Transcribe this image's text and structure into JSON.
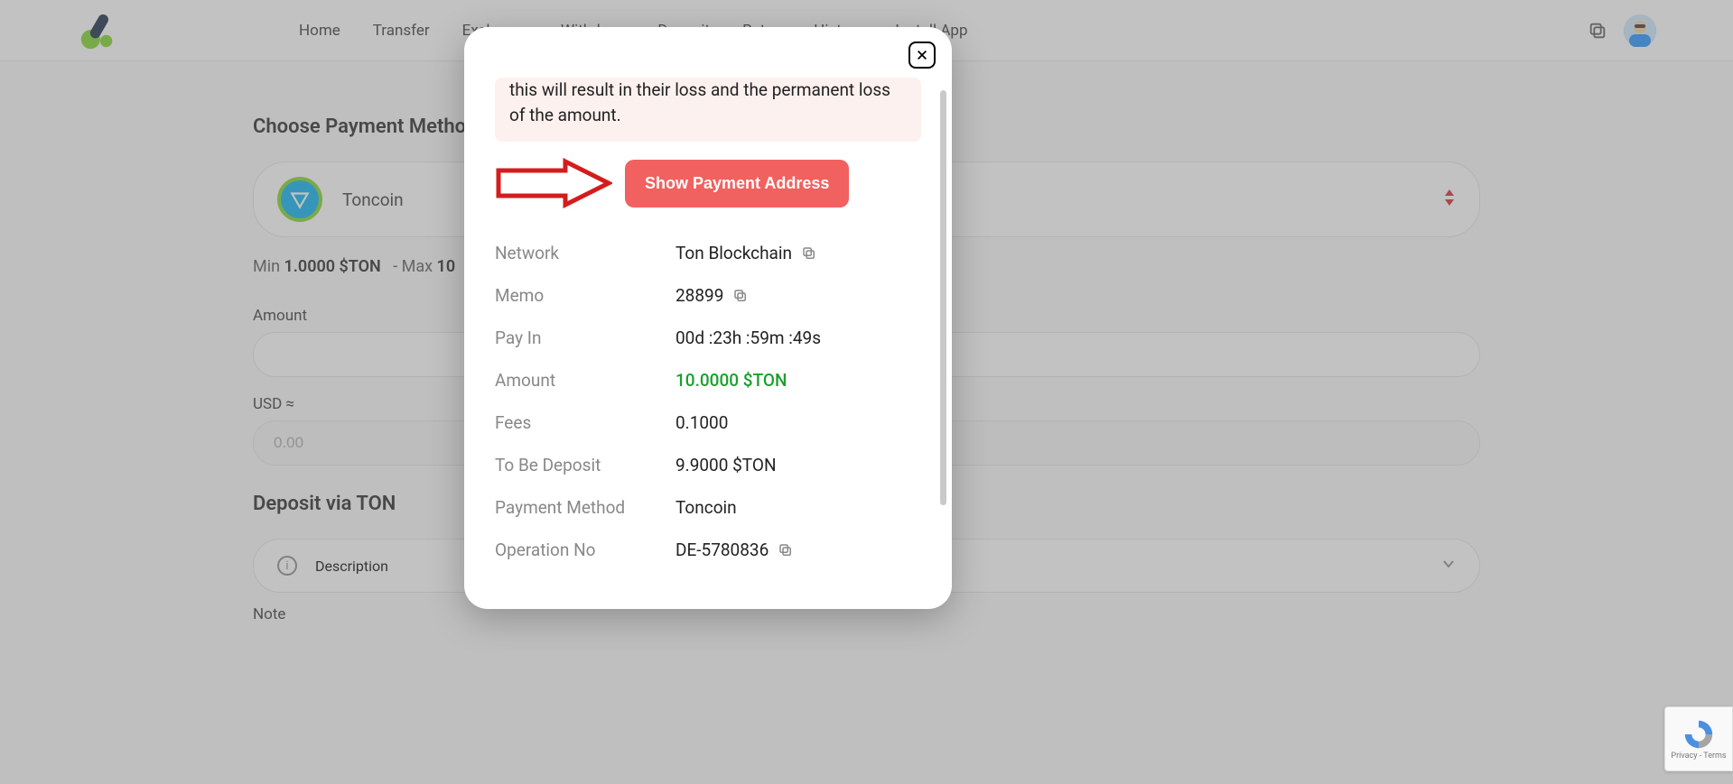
{
  "nav": {
    "home": "Home",
    "transfer": "Transfer",
    "exchange": "Exchange",
    "withdraw": "Withdraw",
    "deposit": "Deposit",
    "rates": "Rates",
    "history": "History",
    "install": "Install App"
  },
  "page": {
    "choose_method_label": "Choose Payment Method",
    "payment_method_selected": "Toncoin",
    "min_label": "Min",
    "min_value": "1.0000 $TON",
    "max_label": "-  Max",
    "max_value": "10",
    "amount_label": "Amount",
    "usd_label": "USD ≈",
    "usd_placeholder": "0.00",
    "deposit_via_label": "Deposit via TON",
    "description_label": "Description",
    "note_label": "Note"
  },
  "modal": {
    "warning_text": "this will result in their loss and the permanent loss of the amount.",
    "show_address_btn": "Show Payment Address",
    "network_k": "Network",
    "network_v": "Ton Blockchain",
    "memo_k": "Memo",
    "memo_v": "28899",
    "payin_k": "Pay In",
    "payin_v": "00d :23h :59m :49s",
    "amount_k": "Amount",
    "amount_v": "10.0000 $TON",
    "fees_k": "Fees",
    "fees_v": "0.1000",
    "tobedeposit_k": "To Be Deposit",
    "tobedeposit_v": "9.9000 $TON",
    "paymethod_k": "Payment Method",
    "paymethod_v": "Toncoin",
    "opno_k": "Operation No",
    "opno_v": "DE-5780836"
  },
  "recaptcha": {
    "privacy": "Privacy",
    "terms": "Terms"
  }
}
